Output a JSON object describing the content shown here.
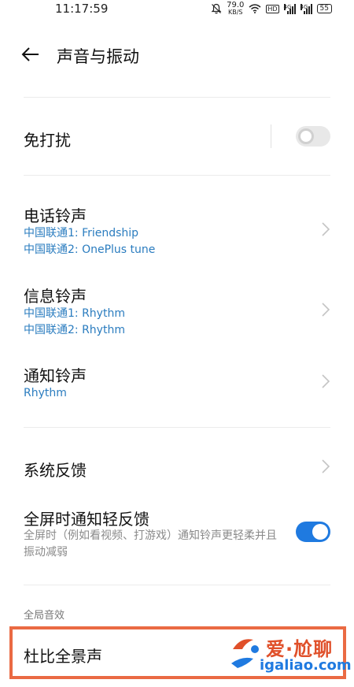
{
  "status_bar": {
    "time": "11:17:59",
    "net_speed_value": "79.0",
    "net_speed_unit": "KB/S",
    "hd_label": "HD",
    "sim1_gen": "4G",
    "sim2_gen": "4G",
    "battery": "55"
  },
  "header": {
    "title": "声音与振动"
  },
  "settings": {
    "dnd": {
      "label": "免打扰",
      "enabled": false
    },
    "phone_ringtone": {
      "label": "电话铃声",
      "sim1": "中国联通1: Friendship",
      "sim2": "中国联通2: OnePlus tune"
    },
    "message_ringtone": {
      "label": "信息铃声",
      "sim1": "中国联通1: Rhythm",
      "sim2": "中国联通2: Rhythm"
    },
    "notification_ringtone": {
      "label": "通知铃声",
      "value": "Rhythm"
    },
    "system_feedback": {
      "label": "系统反馈"
    },
    "fullscreen_light_feedback": {
      "label": "全屏时通知轻反馈",
      "description": "全屏时（例如看视频、打游戏）通知铃声更轻柔并且振动减弱",
      "enabled": true
    },
    "global_audio_section": "全局音效",
    "dolby": {
      "label": "杜比全景声"
    }
  },
  "watermark": {
    "cn": "爱·尬聊",
    "en": "igaliao.com"
  },
  "colors": {
    "accent": "#1f7ae0",
    "link_blue": "#2a7cbf",
    "highlight": "#ea6a43"
  }
}
